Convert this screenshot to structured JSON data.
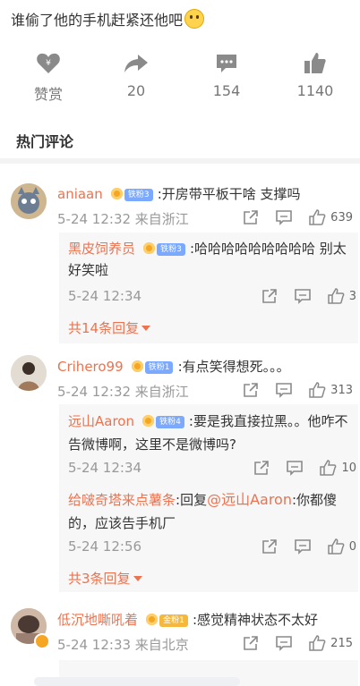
{
  "post": {
    "title": "谁偷了他的手机赶紧还他吧"
  },
  "actions": [
    {
      "name": "reward",
      "label": "赞赏"
    },
    {
      "name": "repost",
      "label": "20"
    },
    {
      "name": "comment",
      "label": "154"
    },
    {
      "name": "like",
      "label": "1140"
    }
  ],
  "section_title": "热门评论",
  "comments": [
    {
      "user": "aniaan",
      "badge": "铁粉3",
      "text": ":开房带平板干啥 支撑吗",
      "meta": "5-24 12:32 来自浙江",
      "likes": "639",
      "reply": {
        "user": "黑皮饲养员",
        "badge": "铁粉3",
        "text": ":哈哈哈哈哈哈哈哈哈 别太好笑啦",
        "meta": "5-24 12:34",
        "likes": "3"
      },
      "more": "共14条回复"
    },
    {
      "user": "Crihero99",
      "badge": "铁粉1",
      "text": ":有点笑得想死。。。",
      "meta": "5-24 12:32 来自浙江",
      "likes": "313",
      "reply": {
        "user": "远山Aaron",
        "badge": "铁粉4",
        "text": ":要是我直接拉黑。。他咋不告微博啊，这里不是微博吗?",
        "meta": "5-24 12:34",
        "likes": "10"
      },
      "reply2": {
        "user": "给啵奇塔来点薯条",
        "prefix": ":回复",
        "mention": "@远山Aaron",
        "text": ":你都傻的，应该告手机厂",
        "meta": "5-24 12:56",
        "likes": "0"
      },
      "more": "共3条回复"
    },
    {
      "user": "低沉地嘶吼着",
      "badge": "金粉1",
      "text": ":感觉精神状态不太好",
      "meta": "5-24 12:33 来自北京",
      "likes": "215"
    }
  ],
  "icons": {
    "accent": "#eb7350",
    "gray": "#8a8a8a"
  }
}
